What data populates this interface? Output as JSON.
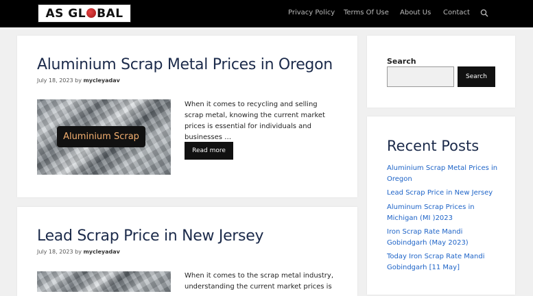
{
  "site": {
    "logo_left": "AS GL",
    "logo_right": "BAL",
    "colors": {
      "header_bg": "#000000",
      "accent_link": "#1d63c7",
      "title": "#1b2a4a"
    }
  },
  "nav": {
    "items": [
      "Privacy Policy",
      "Terms Of Use",
      "About Us",
      "Contact"
    ],
    "search_icon": "search-icon"
  },
  "posts": [
    {
      "title": "Aluminium Scrap Metal Prices in Oregon",
      "date": "July 18, 2023",
      "author_prefix": "by",
      "author": "mycleyadav",
      "thumb_label": "Aluminium Scrap",
      "excerpt": "When it comes to recycling and selling scrap metal, knowing the current market prices is essential for individuals and businesses …",
      "read_more": "Read more"
    },
    {
      "title": "Lead Scrap Price in New Jersey",
      "date": "July 18, 2023",
      "author_prefix": "by",
      "author": "mycleyadav",
      "excerpt": "When it comes to the scrap metal industry, understanding the current market prices is"
    }
  ],
  "sidebar": {
    "search_label": "Search",
    "search_button": "Search",
    "recent_title": "Recent Posts",
    "recent_posts": [
      "Aluminium Scrap Metal Prices in Oregon",
      "Lead Scrap Price in New Jersey",
      "Aluminum Scrap Prices in Michigan (MI )2023",
      "Iron Scrap Rate Mandi Gobindgarh (May 2023)",
      "Today Iron Scrap Rate Mandi Gobindgarh [11 May]"
    ]
  }
}
